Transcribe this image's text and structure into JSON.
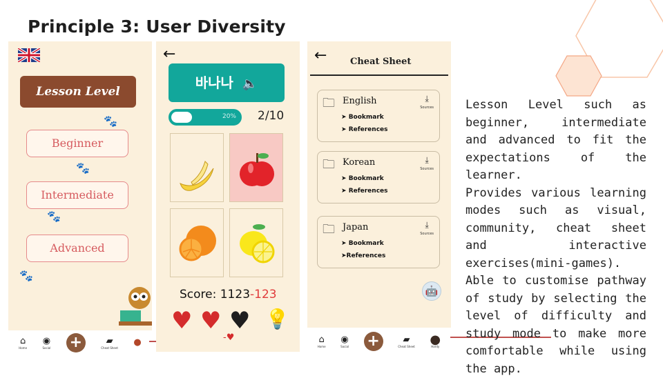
{
  "slide": {
    "title": "Principle 3: User Diversity",
    "description": [
      "Lesson Level such as beginner, intermediate and advanced to fit the expectations of the learner.",
      "Provides various learning modes such as visual, community, cheat sheet and interactive exercises(mini-games).",
      "Able to customise pathway of study by selecting the level of difficulty and study mode to make more comfortable while using the app."
    ],
    "accent_color": "#c0504d",
    "hex_color": "#f8c6a8"
  },
  "screen1": {
    "flag_icon": "uk-flag-icon",
    "header": "Lesson Level",
    "levels": [
      "Beginner",
      "Intermediate",
      "Advanced"
    ],
    "nav": [
      {
        "label": "Home",
        "icon": "home-icon"
      },
      {
        "label": "Social",
        "icon": "compass-icon"
      },
      {
        "label": "",
        "icon": "plus-icon"
      },
      {
        "label": "Cheat Sheet",
        "icon": "folder-icon"
      },
      {
        "label": "",
        "icon": "avatar-icon"
      }
    ]
  },
  "screen2": {
    "word": "바나나",
    "progress_label": "20%",
    "progress": 0.2,
    "count": "2/10",
    "cards": [
      "banana",
      "apple",
      "orange",
      "lemon"
    ],
    "selected_card": "apple",
    "score_label": "Score: 1123",
    "score_penalty": "-123",
    "hearts": [
      "red",
      "red",
      "black"
    ],
    "heart_loss": "-"
  },
  "screen3": {
    "title": "Cheat Sheet",
    "folders": [
      {
        "name": "English",
        "items": [
          "Bookmark",
          "References"
        ],
        "action": "Sources"
      },
      {
        "name": "Korean",
        "items": [
          "Bookmark",
          "References"
        ],
        "action": "Sources"
      },
      {
        "name": "Japan",
        "items": [
          "Bookmark",
          "References"
        ],
        "action": "Sources"
      }
    ],
    "nav": [
      {
        "label": "Home",
        "icon": "home-icon"
      },
      {
        "label": "Social",
        "icon": "compass-icon"
      },
      {
        "label": "",
        "icon": "plus-icon"
      },
      {
        "label": "Cheat Sheet",
        "icon": "folder-icon"
      },
      {
        "label": "Hardy",
        "icon": "avatar-icon"
      }
    ]
  }
}
